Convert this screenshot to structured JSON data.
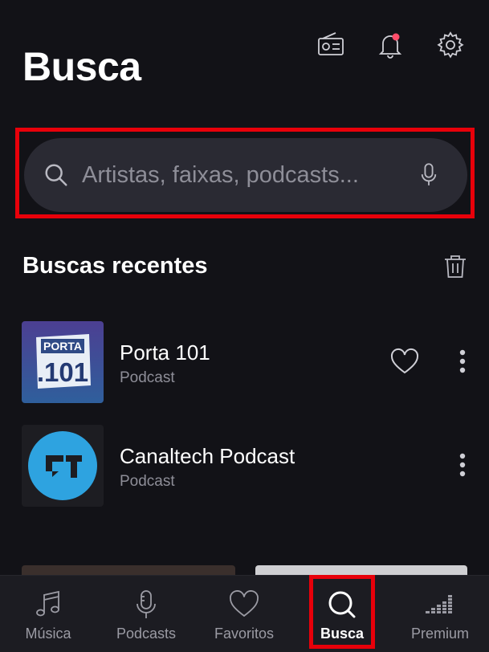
{
  "header": {
    "title": "Busca",
    "icons": [
      "radio-icon",
      "bell-icon",
      "gear-icon"
    ],
    "notification_dot_color": "#ff4d6a"
  },
  "search": {
    "placeholder": "Artistas, faixas, podcasts...",
    "value": ""
  },
  "recent": {
    "title": "Buscas recentes",
    "items": [
      {
        "title": "Porta 101",
        "subtitle": "Podcast",
        "cover_text_top": "PORTA",
        "cover_text_bottom": ".101"
      },
      {
        "title": "Canaltech Podcast",
        "subtitle": "Podcast"
      }
    ]
  },
  "nav": {
    "items": [
      {
        "label": "Música",
        "icon": "music-note-icon"
      },
      {
        "label": "Podcasts",
        "icon": "microphone-icon"
      },
      {
        "label": "Favoritos",
        "icon": "heart-icon"
      },
      {
        "label": "Busca",
        "icon": "search-icon",
        "active": true
      },
      {
        "label": "Premium",
        "icon": "equalizer-icon"
      }
    ]
  },
  "colors": {
    "background": "#121217",
    "search_bg": "#2a2a33",
    "highlight": "#e8000a",
    "canaltech_blue": "#2ea3e0",
    "porta_bg": "#3f4a9a"
  }
}
